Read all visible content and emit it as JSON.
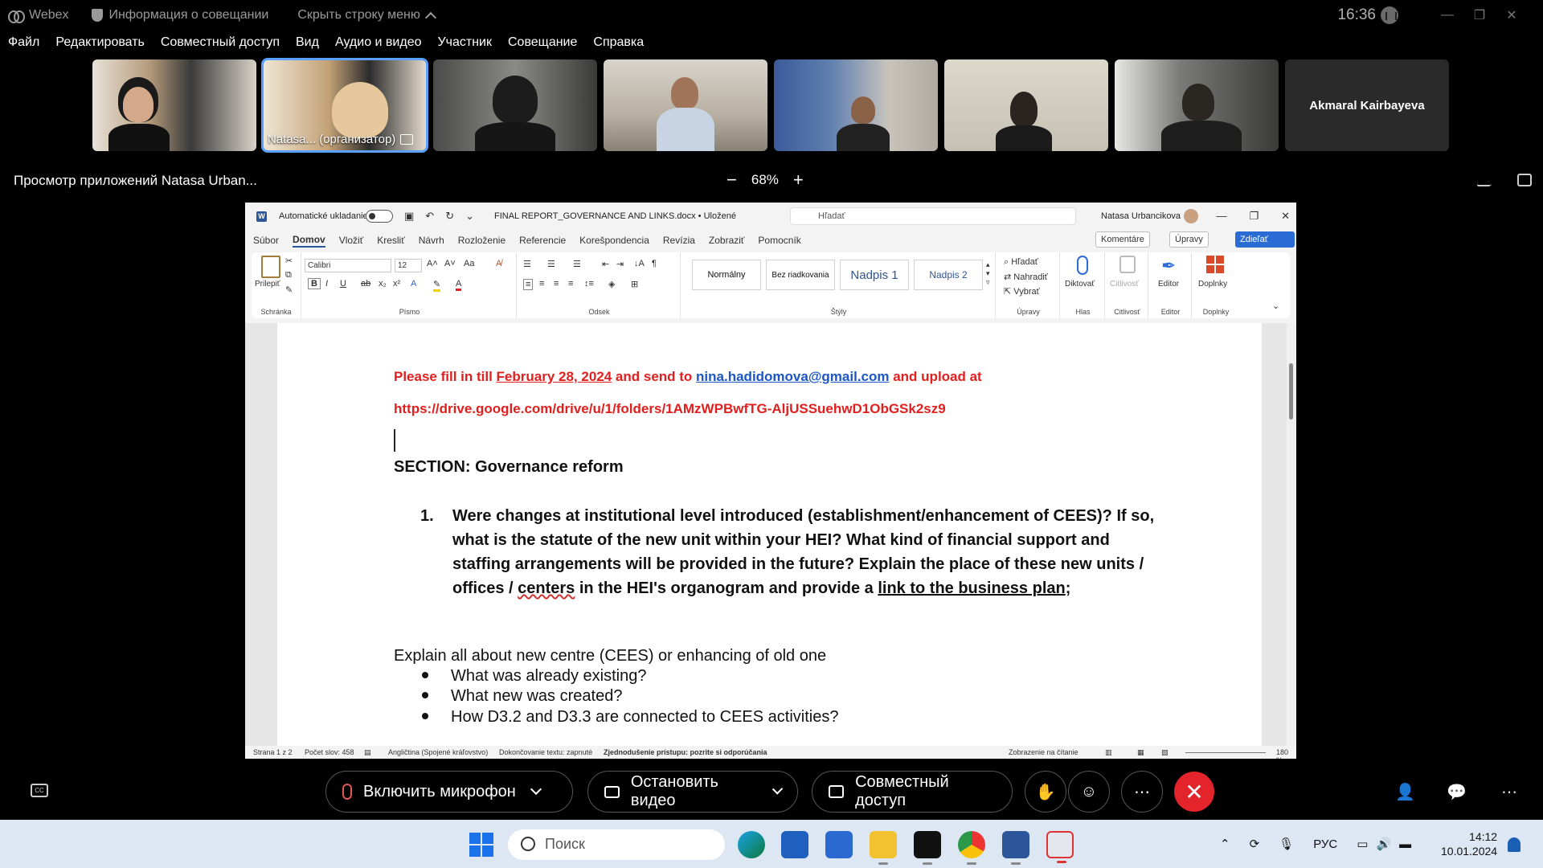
{
  "titlebar": {
    "app": "Webex",
    "meeting_info": "Информация о совещании",
    "hide_menu": "Скрыть строку меню",
    "clock": "16:36"
  },
  "menu": [
    "Файл",
    "Редактировать",
    "Совместный доступ",
    "Вид",
    "Аудио и видео",
    "Участник",
    "Совещание",
    "Справка"
  ],
  "participants": {
    "host_label": "Natasa... (организатор)",
    "no_video_name": "Akmaral Kairbayeva"
  },
  "sharebar": {
    "title": "Просмотр приложений Natasa Urban...",
    "minus": "−",
    "zoom": "68%",
    "plus": "+"
  },
  "word": {
    "autosave": "Automatické ukladanie",
    "doc_title": "FINAL REPORT_GOVERNANCE AND LINKS.docx • Uložené",
    "search_placeholder": "Hľadať",
    "user": "Natasa Urbancikova",
    "tabs": [
      "Súbor",
      "Domov",
      "Vložiť",
      "Kresliť",
      "Návrh",
      "Rozloženie",
      "Referencie",
      "Korešpondencia",
      "Revízia",
      "Zobraziť",
      "Pomocník"
    ],
    "active_tab": "Domov",
    "comments_btn": "Komentáre",
    "edit_btn": "Úpravy",
    "share_btn": "Zdieľať",
    "ribbon": {
      "paste": "Prilepiť",
      "clipboard": "Schránka",
      "font_name": "Calibri",
      "font_size": "12",
      "font_group": "Písmo",
      "paragraph_group": "Odsek",
      "styles_group": "Štýly",
      "styles": [
        "Normálny",
        "Bez riadkovania",
        "Nadpis 1",
        "Nadpis 2"
      ],
      "find": "Hľadať",
      "replace": "Nahradiť",
      "select": "Vybrať",
      "editing_group": "Úpravy",
      "dictate": "Diktovať",
      "voice_group": "Hlas",
      "sensitivity": "Citlivosť",
      "sensitivity_group": "Citlivosť",
      "editor": "Editor",
      "editor_group": "Editor",
      "addins": "Doplnky",
      "addins_group": "Doplnky"
    },
    "doc": {
      "line1_a": "Please fill in till ",
      "line1_date": "February 28, 2024",
      "line1_b": " and send to ",
      "email": "nina.hadidomova@gmail.com",
      "line1_c": " and upload at",
      "url": "https://drive.google.com/drive/u/1/folders/1AMzWPBwfTG-AljUSSuehwD1ObGSk2sz9",
      "section": "SECTION: Governance reform",
      "q_num": "1.",
      "q_text_a": "Were changes at institutional level introduced (establishment/enhancement of CEES)? If so, what is the statute of the new unit within your HEI? What kind of financial support and staffing arrangements will be provided in the future? Explain the place of these new units / offices / ",
      "q_centers": "centers",
      "q_text_b": " in the HEI's organogram and provide a ",
      "q_link": "link to the business plan",
      "q_end": ";",
      "para": "Explain all about new centre (CEES) or enhancing of old one",
      "bullets": [
        "What was already existing?",
        "What new was created?",
        "How D3.2 and D3.3 are connected to CEES activities?"
      ]
    },
    "status": {
      "page": "Strana 1 z 2",
      "words": "Počet slov: 458",
      "lang": "Angličtina (Spojené kráľovstvo)",
      "autocomplete": "Dokončovanie textu: zapnuté",
      "accessibility": "Zjednodušenie prístupu: pozrite si odporúčania",
      "reading": "Zobrazenie na čítanie",
      "zoom": "180 %"
    }
  },
  "controls": {
    "mic": "Включить микрофон",
    "video": "Остановить видео",
    "share": "Совместный доступ"
  },
  "taskbar": {
    "search": "Поиск",
    "lang": "РУС",
    "time": "14:12",
    "date": "10.01.2024"
  }
}
